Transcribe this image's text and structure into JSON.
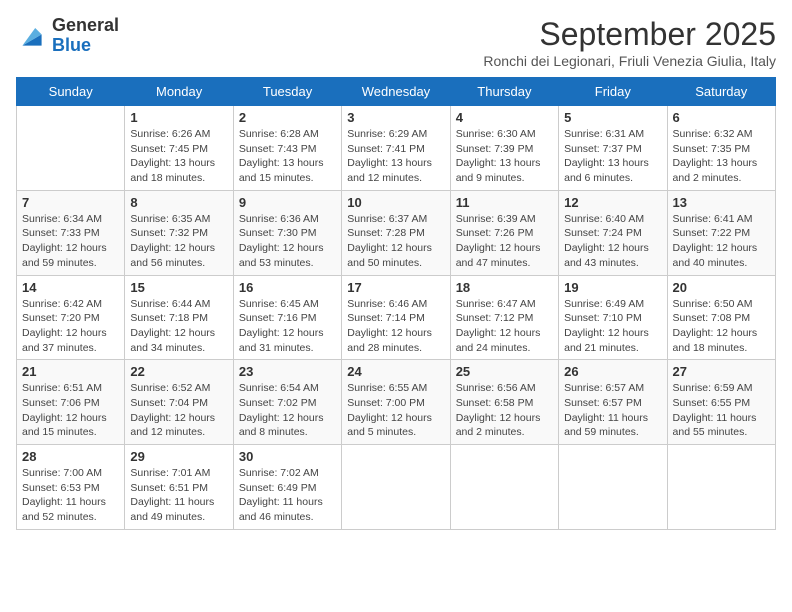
{
  "logo": {
    "general": "General",
    "blue": "Blue"
  },
  "title": "September 2025",
  "subtitle": "Ronchi dei Legionari, Friuli Venezia Giulia, Italy",
  "days_of_week": [
    "Sunday",
    "Monday",
    "Tuesday",
    "Wednesday",
    "Thursday",
    "Friday",
    "Saturday"
  ],
  "weeks": [
    [
      {
        "day": "",
        "sunrise": "",
        "sunset": "",
        "daylight": ""
      },
      {
        "day": "1",
        "sunrise": "Sunrise: 6:26 AM",
        "sunset": "Sunset: 7:45 PM",
        "daylight": "Daylight: 13 hours and 18 minutes."
      },
      {
        "day": "2",
        "sunrise": "Sunrise: 6:28 AM",
        "sunset": "Sunset: 7:43 PM",
        "daylight": "Daylight: 13 hours and 15 minutes."
      },
      {
        "day": "3",
        "sunrise": "Sunrise: 6:29 AM",
        "sunset": "Sunset: 7:41 PM",
        "daylight": "Daylight: 13 hours and 12 minutes."
      },
      {
        "day": "4",
        "sunrise": "Sunrise: 6:30 AM",
        "sunset": "Sunset: 7:39 PM",
        "daylight": "Daylight: 13 hours and 9 minutes."
      },
      {
        "day": "5",
        "sunrise": "Sunrise: 6:31 AM",
        "sunset": "Sunset: 7:37 PM",
        "daylight": "Daylight: 13 hours and 6 minutes."
      },
      {
        "day": "6",
        "sunrise": "Sunrise: 6:32 AM",
        "sunset": "Sunset: 7:35 PM",
        "daylight": "Daylight: 13 hours and 2 minutes."
      }
    ],
    [
      {
        "day": "7",
        "sunrise": "Sunrise: 6:34 AM",
        "sunset": "Sunset: 7:33 PM",
        "daylight": "Daylight: 12 hours and 59 minutes."
      },
      {
        "day": "8",
        "sunrise": "Sunrise: 6:35 AM",
        "sunset": "Sunset: 7:32 PM",
        "daylight": "Daylight: 12 hours and 56 minutes."
      },
      {
        "day": "9",
        "sunrise": "Sunrise: 6:36 AM",
        "sunset": "Sunset: 7:30 PM",
        "daylight": "Daylight: 12 hours and 53 minutes."
      },
      {
        "day": "10",
        "sunrise": "Sunrise: 6:37 AM",
        "sunset": "Sunset: 7:28 PM",
        "daylight": "Daylight: 12 hours and 50 minutes."
      },
      {
        "day": "11",
        "sunrise": "Sunrise: 6:39 AM",
        "sunset": "Sunset: 7:26 PM",
        "daylight": "Daylight: 12 hours and 47 minutes."
      },
      {
        "day": "12",
        "sunrise": "Sunrise: 6:40 AM",
        "sunset": "Sunset: 7:24 PM",
        "daylight": "Daylight: 12 hours and 43 minutes."
      },
      {
        "day": "13",
        "sunrise": "Sunrise: 6:41 AM",
        "sunset": "Sunset: 7:22 PM",
        "daylight": "Daylight: 12 hours and 40 minutes."
      }
    ],
    [
      {
        "day": "14",
        "sunrise": "Sunrise: 6:42 AM",
        "sunset": "Sunset: 7:20 PM",
        "daylight": "Daylight: 12 hours and 37 minutes."
      },
      {
        "day": "15",
        "sunrise": "Sunrise: 6:44 AM",
        "sunset": "Sunset: 7:18 PM",
        "daylight": "Daylight: 12 hours and 34 minutes."
      },
      {
        "day": "16",
        "sunrise": "Sunrise: 6:45 AM",
        "sunset": "Sunset: 7:16 PM",
        "daylight": "Daylight: 12 hours and 31 minutes."
      },
      {
        "day": "17",
        "sunrise": "Sunrise: 6:46 AM",
        "sunset": "Sunset: 7:14 PM",
        "daylight": "Daylight: 12 hours and 28 minutes."
      },
      {
        "day": "18",
        "sunrise": "Sunrise: 6:47 AM",
        "sunset": "Sunset: 7:12 PM",
        "daylight": "Daylight: 12 hours and 24 minutes."
      },
      {
        "day": "19",
        "sunrise": "Sunrise: 6:49 AM",
        "sunset": "Sunset: 7:10 PM",
        "daylight": "Daylight: 12 hours and 21 minutes."
      },
      {
        "day": "20",
        "sunrise": "Sunrise: 6:50 AM",
        "sunset": "Sunset: 7:08 PM",
        "daylight": "Daylight: 12 hours and 18 minutes."
      }
    ],
    [
      {
        "day": "21",
        "sunrise": "Sunrise: 6:51 AM",
        "sunset": "Sunset: 7:06 PM",
        "daylight": "Daylight: 12 hours and 15 minutes."
      },
      {
        "day": "22",
        "sunrise": "Sunrise: 6:52 AM",
        "sunset": "Sunset: 7:04 PM",
        "daylight": "Daylight: 12 hours and 12 minutes."
      },
      {
        "day": "23",
        "sunrise": "Sunrise: 6:54 AM",
        "sunset": "Sunset: 7:02 PM",
        "daylight": "Daylight: 12 hours and 8 minutes."
      },
      {
        "day": "24",
        "sunrise": "Sunrise: 6:55 AM",
        "sunset": "Sunset: 7:00 PM",
        "daylight": "Daylight: 12 hours and 5 minutes."
      },
      {
        "day": "25",
        "sunrise": "Sunrise: 6:56 AM",
        "sunset": "Sunset: 6:58 PM",
        "daylight": "Daylight: 12 hours and 2 minutes."
      },
      {
        "day": "26",
        "sunrise": "Sunrise: 6:57 AM",
        "sunset": "Sunset: 6:57 PM",
        "daylight": "Daylight: 11 hours and 59 minutes."
      },
      {
        "day": "27",
        "sunrise": "Sunrise: 6:59 AM",
        "sunset": "Sunset: 6:55 PM",
        "daylight": "Daylight: 11 hours and 55 minutes."
      }
    ],
    [
      {
        "day": "28",
        "sunrise": "Sunrise: 7:00 AM",
        "sunset": "Sunset: 6:53 PM",
        "daylight": "Daylight: 11 hours and 52 minutes."
      },
      {
        "day": "29",
        "sunrise": "Sunrise: 7:01 AM",
        "sunset": "Sunset: 6:51 PM",
        "daylight": "Daylight: 11 hours and 49 minutes."
      },
      {
        "day": "30",
        "sunrise": "Sunrise: 7:02 AM",
        "sunset": "Sunset: 6:49 PM",
        "daylight": "Daylight: 11 hours and 46 minutes."
      },
      {
        "day": "",
        "sunrise": "",
        "sunset": "",
        "daylight": ""
      },
      {
        "day": "",
        "sunrise": "",
        "sunset": "",
        "daylight": ""
      },
      {
        "day": "",
        "sunrise": "",
        "sunset": "",
        "daylight": ""
      },
      {
        "day": "",
        "sunrise": "",
        "sunset": "",
        "daylight": ""
      }
    ]
  ]
}
